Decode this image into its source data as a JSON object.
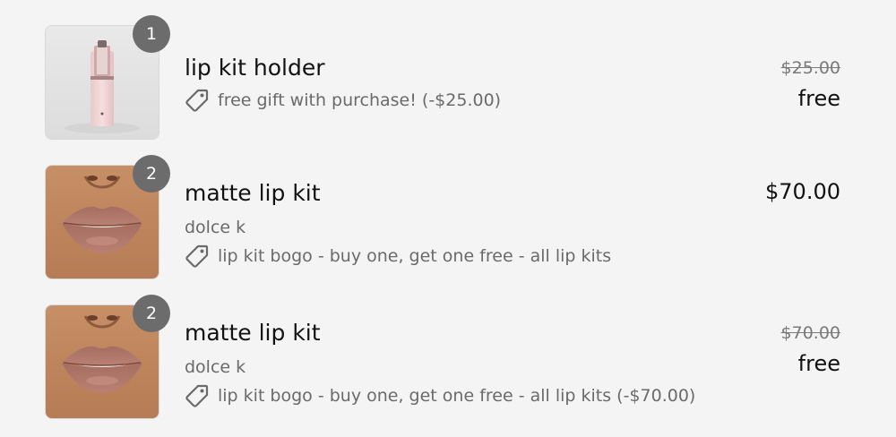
{
  "cart": {
    "items": [
      {
        "quantity": "1",
        "name": "lip kit holder",
        "discount": "free gift with purchase! (-$25.00)",
        "original_price": "$25.00",
        "final_price": "free",
        "image_icon": "lip-kit-holder-image"
      },
      {
        "quantity": "2",
        "name": "matte lip kit",
        "variant": "dolce k",
        "discount": "lip kit bogo - buy one, get one free - all lip kits",
        "price": "$70.00",
        "image_icon": "lips-image"
      },
      {
        "quantity": "2",
        "name": "matte lip kit",
        "variant": "dolce k",
        "discount": "lip kit bogo - buy one, get one free - all lip kits (-$70.00)",
        "original_price": "$70.00",
        "final_price": "free",
        "image_icon": "lips-image"
      }
    ]
  },
  "colors": {
    "background": "#f4f4f4",
    "badge": "#6c6c6c",
    "muted_text": "#6a6a6a",
    "primary_text": "#111111"
  }
}
